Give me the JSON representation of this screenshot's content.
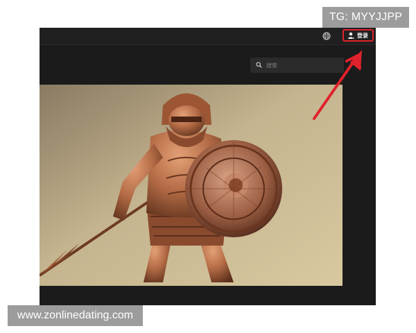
{
  "header": {
    "login_label": "登录",
    "icons": [
      "globe-icon",
      "user-icon"
    ]
  },
  "search": {
    "placeholder": "搜索"
  },
  "overlays": {
    "tg_text": "TG: MYYJJPP",
    "site_text": "www.zonlinedating.com"
  },
  "colors": {
    "highlight": "#e0222c",
    "frame_bg": "#1b1b1b",
    "badge_bg": "#9c9c9c"
  }
}
